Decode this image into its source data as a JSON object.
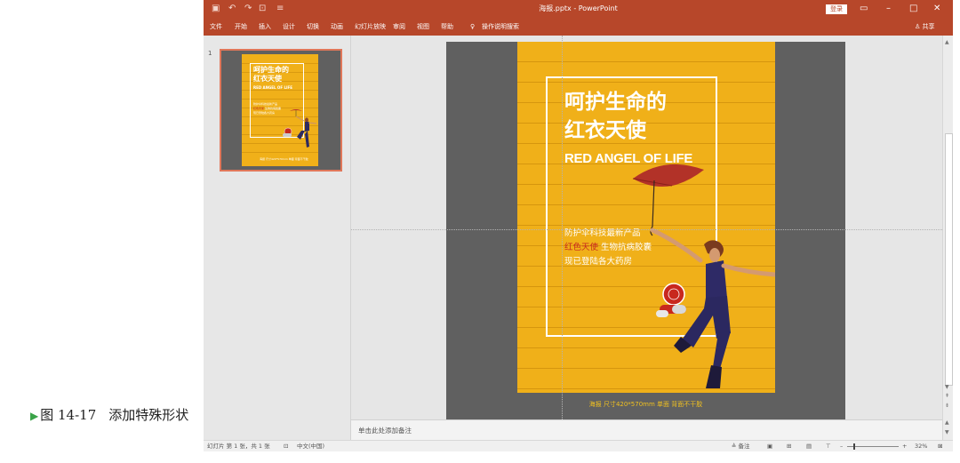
{
  "caption": {
    "figure_num": "图 14-17",
    "text": "添加特殊形状"
  },
  "titlebar": {
    "title": "海报.pptx - PowerPoint",
    "login": "登录",
    "minimize": "–",
    "restore": "□",
    "close": "✕"
  },
  "ribbon": {
    "tabs": [
      "文件",
      "开始",
      "插入",
      "设计",
      "切换",
      "动画",
      "幻灯片放映",
      "审阅",
      "视图",
      "帮助"
    ],
    "search_label": "操作说明搜索",
    "share_label": "共享"
  },
  "thumbnail": {
    "slide_number": "1"
  },
  "poster": {
    "title_line1": "呵护生命的",
    "title_line2": "红衣天使",
    "subtitle_en": "RED ANGEL OF LIFE",
    "body_line1": "防护伞科技最新产品",
    "body_line2_red": "红色天使",
    "body_line2_rest": " 生物抗病胶囊",
    "body_line3": "现已登陆各大药房",
    "footer": "海报 尺寸420*570mm 单面 背面不干胶"
  },
  "notes": {
    "placeholder": "单击此处添加备注"
  },
  "statusbar": {
    "slide_info": "幻灯片 第 1 张，共 1 张",
    "language": "中文(中国)",
    "notes_label": "备注",
    "zoom": "32%"
  },
  "colors": {
    "accent": "#b7472a",
    "poster_bg": "#f0b019",
    "stage": "#606060"
  }
}
